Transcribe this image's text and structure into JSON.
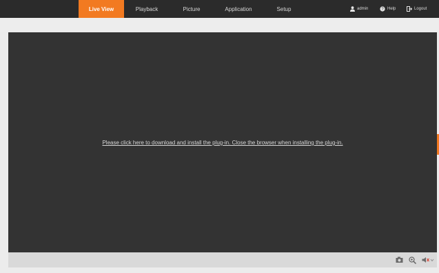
{
  "nav": {
    "tabs": [
      {
        "label": "Live View",
        "active": true
      },
      {
        "label": "Playback",
        "active": false
      },
      {
        "label": "Picture",
        "active": false
      },
      {
        "label": "Application",
        "active": false
      },
      {
        "label": "Setup",
        "active": false
      }
    ],
    "user": {
      "label": "admin",
      "icon": "user-icon"
    },
    "help": {
      "label": "Help",
      "icon": "help-icon"
    },
    "logout": {
      "label": "Logout",
      "icon": "logout-icon"
    }
  },
  "video": {
    "plugin_message": "Please click here to download and install the plug-in. Close the browser when installing the plug-in."
  },
  "toolbar": {
    "tools": [
      {
        "icon": "camera-icon"
      },
      {
        "icon": "zoom-icon"
      },
      {
        "icon": "speaker-icon"
      }
    ]
  },
  "colors": {
    "accent": "#f27a21",
    "topbar": "#2b2b2b",
    "video_background": "#333333"
  }
}
